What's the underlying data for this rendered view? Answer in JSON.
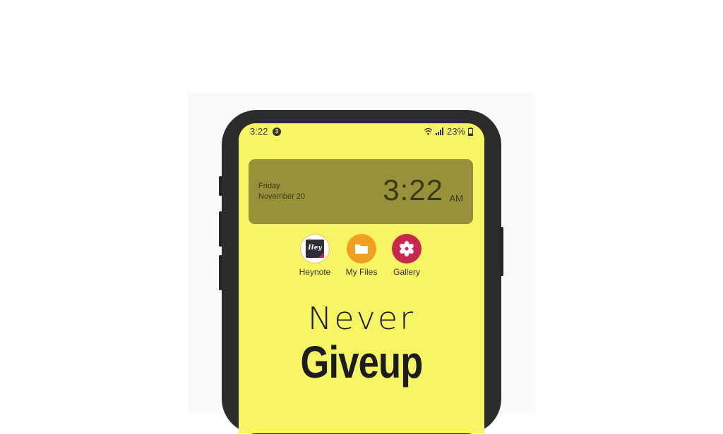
{
  "status_bar": {
    "time": "3:22",
    "notification_count": "3",
    "battery_percent": "23%",
    "icons": [
      "wifi-icon",
      "signal-icon",
      "battery-icon"
    ]
  },
  "clock_widget": {
    "day": "Friday",
    "date": "November 20",
    "time": "3:22",
    "ampm": "AM"
  },
  "apps": [
    {
      "label": "Heynote",
      "icon": "heynote-icon",
      "icon_text": "Hey",
      "color": "#ffffff"
    },
    {
      "label": "My Files",
      "icon": "folder-icon",
      "color": "#f0a020"
    },
    {
      "label": "Gallery",
      "icon": "gallery-flower-icon",
      "color": "#c8284e"
    }
  ],
  "wallpaper": {
    "line1": "Never",
    "line2": "Giveup",
    "background": "#f7f563"
  }
}
